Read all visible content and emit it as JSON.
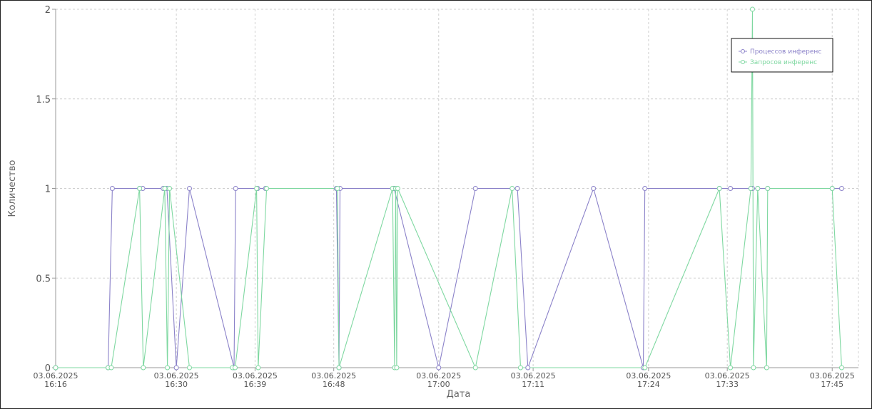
{
  "chart_data": {
    "type": "line",
    "xlabel": "Дата",
    "ylabel": "Количество",
    "ylim": [
      0,
      2
    ],
    "yticks": [
      0,
      0.5,
      1,
      1.5,
      2
    ],
    "ytick_labels": [
      "0",
      "0.5",
      "1",
      "1.5",
      "2"
    ],
    "xlim": [
      16.27,
      17.8
    ],
    "xticks": [
      16.27,
      16.5,
      16.65,
      16.8,
      17.0,
      17.18,
      17.4,
      17.55,
      17.75
    ],
    "xtick_labels": [
      [
        "03.06.2025",
        "16:16"
      ],
      [
        "03.06.2025",
        "16:30"
      ],
      [
        "03.06.2025",
        "16:39"
      ],
      [
        "03.06.2025",
        "16:48"
      ],
      [
        "03.06.2025",
        "17:00"
      ],
      [
        "03.06.2025",
        "17:11"
      ],
      [
        "03.06.2025",
        "17:24"
      ],
      [
        "03.06.2025",
        "17:33"
      ],
      [
        "03.06.2025",
        "17:45"
      ]
    ],
    "grid": true,
    "legend_position": "top-right",
    "series": [
      {
        "name": "Процессов инференс",
        "color": "#8b82c9",
        "x": [
          16.27,
          16.37,
          16.378,
          16.43,
          16.436,
          16.475,
          16.482,
          16.5,
          16.525,
          16.61,
          16.613,
          16.655,
          16.67,
          16.805,
          16.81,
          16.812,
          16.915,
          16.915,
          17.0,
          17.07,
          17.15,
          17.17,
          17.295,
          17.39,
          17.393,
          17.535,
          17.556,
          17.595,
          17.598,
          17.608,
          17.627,
          17.75,
          17.768
        ],
        "y": [
          0,
          0,
          1,
          1,
          1,
          1,
          1,
          0,
          1,
          0,
          1,
          1,
          1,
          1,
          0,
          1,
          1,
          1,
          0,
          1,
          1,
          0,
          1,
          0,
          1,
          1,
          1,
          1,
          1,
          1,
          1,
          1,
          1
        ]
      },
      {
        "name": "Запросов инференс",
        "color": "#7fd8a1",
        "x": [
          16.27,
          16.37,
          16.376,
          16.43,
          16.437,
          16.478,
          16.483,
          16.487,
          16.525,
          16.607,
          16.612,
          16.653,
          16.656,
          16.672,
          16.807,
          16.81,
          16.912,
          16.916,
          16.918,
          16.92,
          16.922,
          17.07,
          17.14,
          17.156,
          17.393,
          17.535,
          17.556,
          17.595,
          17.598,
          17.6,
          17.608,
          17.625,
          17.627,
          17.75,
          17.768
        ],
        "y": [
          0,
          0,
          0,
          1,
          0,
          1,
          0,
          1,
          0,
          0,
          0,
          1,
          0,
          1,
          1,
          0,
          1,
          0,
          1,
          0,
          1,
          0,
          1,
          0,
          0,
          1,
          0,
          1,
          2,
          0,
          1,
          0,
          1,
          1,
          0
        ]
      }
    ]
  }
}
